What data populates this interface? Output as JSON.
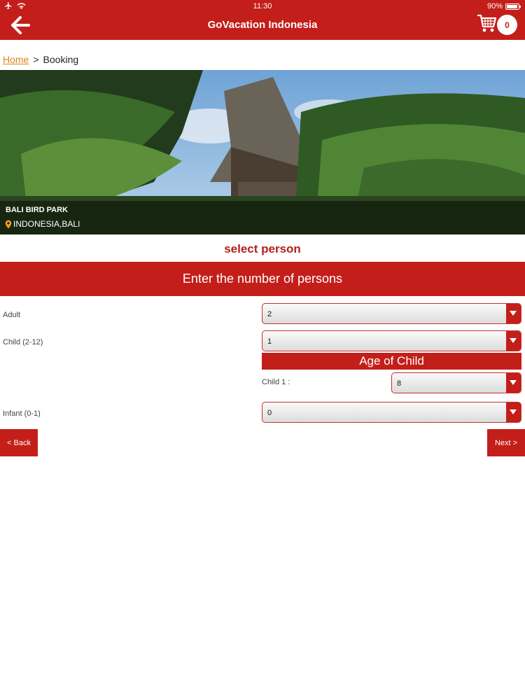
{
  "status_bar": {
    "time": "11:30",
    "battery": "90%"
  },
  "nav": {
    "title": "GoVacation Indonesia",
    "cart_count": "0"
  },
  "breadcrumb": {
    "home": "Home",
    "separator": ">",
    "current": "Booking"
  },
  "hero": {
    "name": "BALI BIRD PARK",
    "location": "INDONESIA,BALI"
  },
  "section_title": "select person",
  "banner": "Enter the number of persons",
  "fields": {
    "adult": {
      "label": "Adult",
      "value": "2"
    },
    "child": {
      "label": "Child (2-12)",
      "value": "1"
    },
    "infant": {
      "label": "Infant (0-1)",
      "value": "0"
    }
  },
  "child_ages": {
    "title": "Age of Child",
    "child1_label": "Child 1 :",
    "child1_value": "8"
  },
  "buttons": {
    "back": "< Back",
    "next": "Next >"
  },
  "colors": {
    "brand_red": "#c41e1a",
    "title_red": "#b3201c",
    "link_orange": "#e0821c"
  },
  "icons": [
    "airplane-icon",
    "wifi-icon",
    "battery-icon",
    "back-arrow-icon",
    "cart-icon",
    "location-pin-icon",
    "dropdown-arrow-icon"
  ]
}
